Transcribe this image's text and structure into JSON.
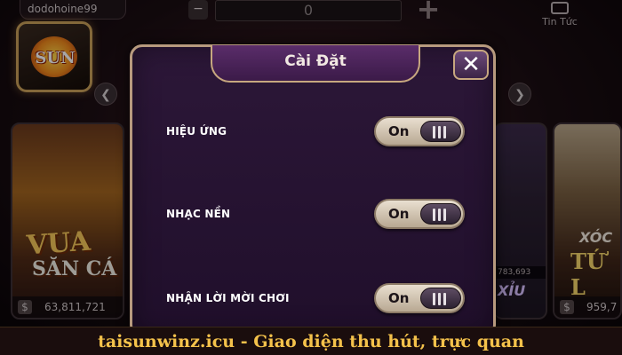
{
  "header": {
    "username": "dodohoine99",
    "coin_minus": "−",
    "coin_value": "0",
    "coin_plus": "+",
    "news_label": "Tin Tức",
    "news_icon": "news-icon",
    "logo_text": "SUN"
  },
  "lobby": {
    "prev_arrow": "❮",
    "next_arrow": "❯",
    "left_card": {
      "title": "VUA",
      "title2": "SĂN CÁ",
      "jackpot_symbol": "$",
      "jackpot": "63,811,721"
    },
    "mid_card": {
      "mini_value": "783,693",
      "label": "XỈU"
    },
    "right_card": {
      "title": "XÓC",
      "title2": "TỨ L",
      "jackpot_symbol": "$",
      "jackpot": "959,7"
    }
  },
  "settings_modal": {
    "title": "Cài Đặt",
    "close_label": "✕",
    "rows": [
      {
        "label": "HIỆU ỨNG",
        "state": "On"
      },
      {
        "label": "NHẠC NỀN",
        "state": "On"
      },
      {
        "label": "NHẬN LỜI MỜI CHƠI",
        "state": "On"
      }
    ]
  },
  "footer": {
    "caption": "taisunwinz.icu - Giao diện thu hút, trực quan"
  },
  "colors": {
    "accent_gold": "#f4c24b",
    "modal_bg": "#200f2b",
    "modal_border": "#b79a7e"
  }
}
